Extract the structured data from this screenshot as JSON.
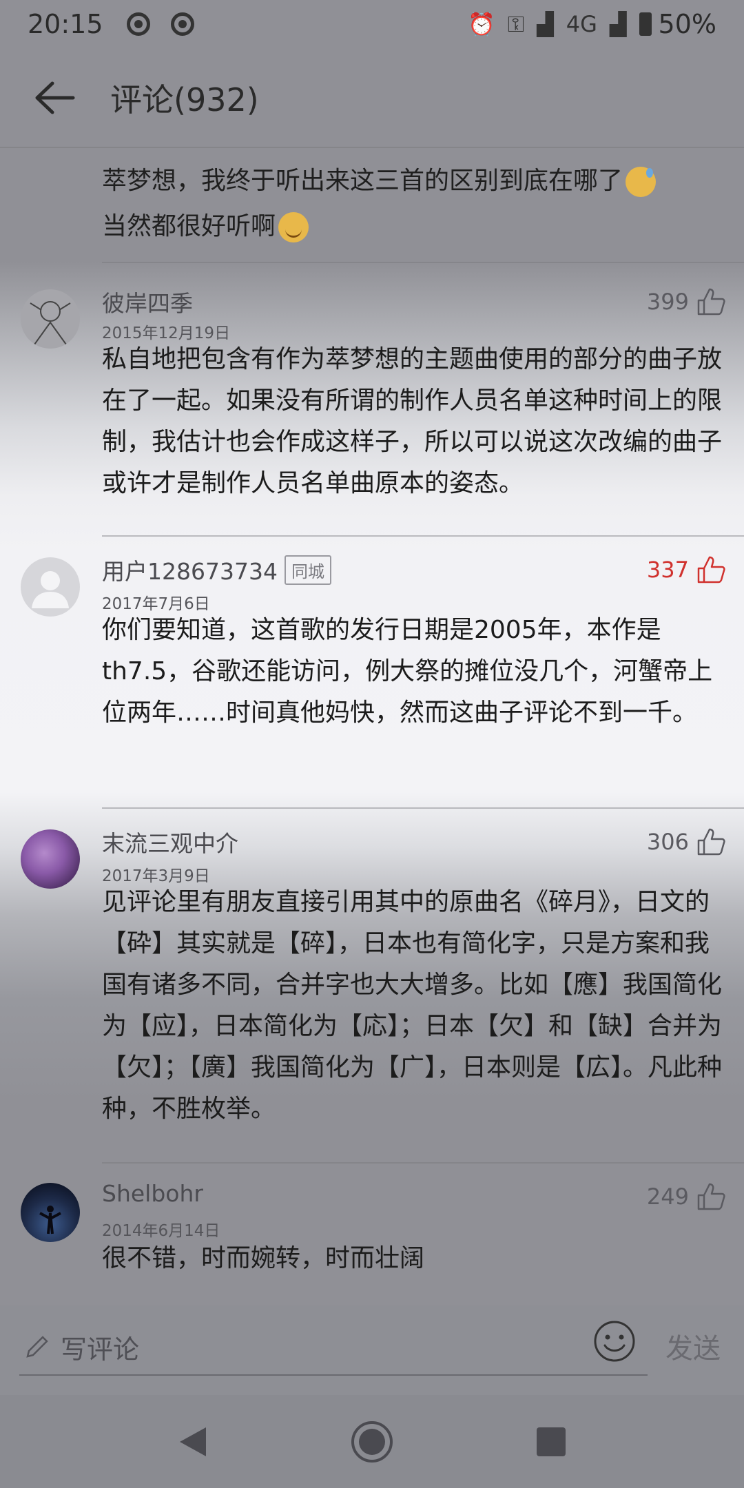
{
  "status_bar": {
    "time": "20:15",
    "network": "4G",
    "battery": "50%"
  },
  "header": {
    "title": "评论(932)"
  },
  "partial_comment": {
    "line1": "萃梦想，我终于听出来这三首的区别到底在哪了",
    "line2": "当然都很好听啊"
  },
  "comments": [
    {
      "name": "彼岸四季",
      "date": "2015年12月19日",
      "likes": "399",
      "liked": false,
      "text": "私自地把包含有作为萃梦想的主题曲使用的部分的曲子放在了一起。如果没有所谓的制作人员名单这种时间上的限制，我估计也会作成这样子，所以可以说这次改编的曲子或许才是制作人员名单曲原本的姿态。"
    },
    {
      "name": "用户128673734",
      "badge": "同城",
      "date": "2017年7月6日",
      "likes": "337",
      "liked": true,
      "text": "你们要知道，这首歌的发行日期是2005年，本作是th7.5，谷歌还能访问，例大祭的摊位没几个，河蟹帝上位两年……时间真他妈快，然而这曲子评论不到一千。"
    },
    {
      "name": "末流三观中介",
      "date": "2017年3月9日",
      "likes": "306",
      "liked": false,
      "text": "见评论里有朋友直接引用其中的原曲名《碎月》，日文的【砕】其实就是【碎】，日本也有简化字，只是方案和我国有诸多不同，合并字也大大增多。比如【應】我国简化为【应】，日本简化为【応】；日本【欠】和【缺】合并为【欠】；【廣】我国简化为【广】，日本则是【広】。凡此种种，不胜枚举。"
    },
    {
      "name": "Shelbohr",
      "date": "2014年6月14日",
      "likes": "249",
      "liked": false,
      "text": "很不错，时而婉转，时而壮阔"
    }
  ],
  "input": {
    "placeholder": "写评论",
    "send_label": "发送"
  },
  "colors": {
    "accent_like": "#d0312d"
  }
}
